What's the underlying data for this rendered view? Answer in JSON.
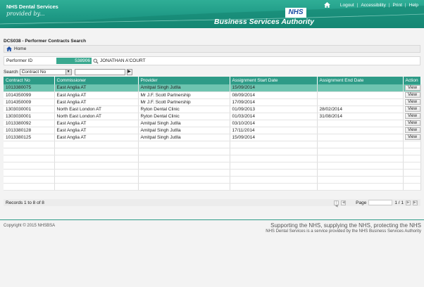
{
  "header": {
    "brand_title": "NHS Dental Services",
    "tagline": "provided by...",
    "nhs_logo": "NHS",
    "authority": "Business Services Authority",
    "nav": {
      "logout": "Logout",
      "accessibility": "Accessibility",
      "print": "Print",
      "help": "Help"
    }
  },
  "page": {
    "title": "DCS038 - Performer Contracts Search",
    "breadcrumb": "Home"
  },
  "performer": {
    "label": "Performer ID",
    "id": "538906",
    "name": "JONATHAN A'COURT"
  },
  "search": {
    "label": "Search",
    "selected": "Contract No",
    "value": ""
  },
  "table": {
    "headers": [
      "Contract No",
      "Commissioner",
      "Provider",
      "Assignment Start Date",
      "Assignment End Date",
      "Action"
    ],
    "rows": [
      {
        "contract": "1013380075",
        "commissioner": "East Anglia AT",
        "provider": "Amitpal Singh Jutlla",
        "start": "15/09/2014",
        "end": "",
        "action": "View"
      },
      {
        "contract": "1014350099",
        "commissioner": "East Anglia AT",
        "provider": "Mr J.F. Scott Partnership",
        "start": "08/09/2014",
        "end": "",
        "action": "View"
      },
      {
        "contract": "1014350009",
        "commissioner": "East Anglia AT",
        "provider": "Mr J.F. Scott Partnership",
        "start": "17/09/2014",
        "end": "",
        "action": "View"
      },
      {
        "contract": "1303030001",
        "commissioner": "North East London AT",
        "provider": "Ryton Dental Clinic",
        "start": "01/09/2013",
        "end": "28/02/2014",
        "action": "View"
      },
      {
        "contract": "1303030001",
        "commissioner": "North East London AT",
        "provider": "Ryton Dental Clinic",
        "start": "01/03/2014",
        "end": "31/08/2014",
        "action": "View"
      },
      {
        "contract": "1013380092",
        "commissioner": "East Anglia AT",
        "provider": "Amitpal Singh Jutlla",
        "start": "03/10/2014",
        "end": "",
        "action": "View"
      },
      {
        "contract": "1013380128",
        "commissioner": "East Anglia AT",
        "provider": "Amitpal Singh Jutlla",
        "start": "17/11/2014",
        "end": "",
        "action": "View"
      },
      {
        "contract": "1013380125",
        "commissioner": "East Anglia AT",
        "provider": "Amitpal Singh Jutlla",
        "start": "15/09/2014",
        "end": "",
        "action": "View"
      }
    ]
  },
  "records": {
    "text": "Records 1 to 8 of 8",
    "page_label": "Page",
    "page_count": "1 / 1"
  },
  "footer": {
    "copyright": "Copyright © 2015 NHSBSA",
    "slogan": "Supporting the NHS, supplying the NHS, protecting the NHS",
    "service_note": "NHS Dental Services is a service provided by the NHS Business Services Authority"
  },
  "colors": {
    "primary": "#2e9b87",
    "selected_row": "#6ec4b0"
  }
}
